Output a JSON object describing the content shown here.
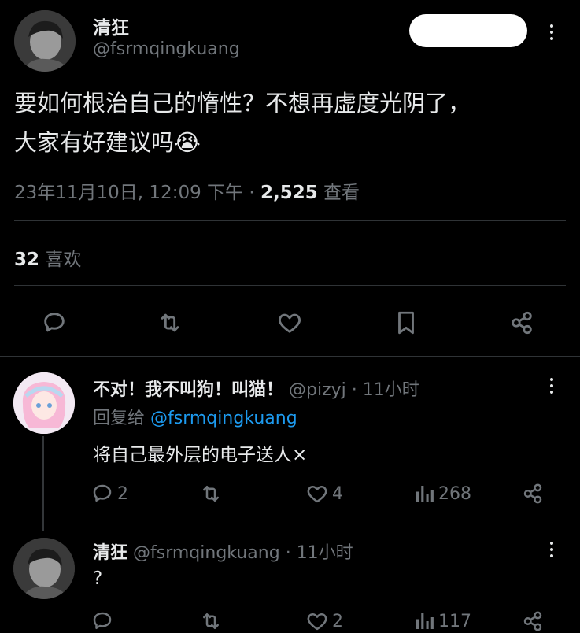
{
  "main_tweet": {
    "display_name": "清狂",
    "handle": "@fsrmqingkuang",
    "text_line1": "要如何根治自己的惰性？不想再虚度光阴了，",
    "text_line2": "大家有好建议吗😭",
    "timestamp": "23年11月10日, 12:09 下午",
    "separator": "·",
    "views_count": "2,525",
    "views_label": "查看",
    "likes_count": "32",
    "likes_label": "喜欢"
  },
  "reply1": {
    "display_name": "不对！我不叫狗！叫猫！",
    "handle": "@pizyj",
    "time": "· 11小时",
    "reply_to_label": "回复给",
    "reply_to_handle": "@fsrmqingkuang",
    "text": "将自己最外层的电子送人×",
    "replies": "2",
    "likes": "4",
    "views": "268"
  },
  "reply2": {
    "display_name": "清狂",
    "handle": "@fsrmqingkuang",
    "time": "· 11小时",
    "text": "?",
    "likes": "2",
    "views": "117"
  },
  "colors": {
    "accent": "#1d9bf0",
    "muted": "#71767b",
    "text": "#e7e9ea",
    "bg": "#000000"
  }
}
